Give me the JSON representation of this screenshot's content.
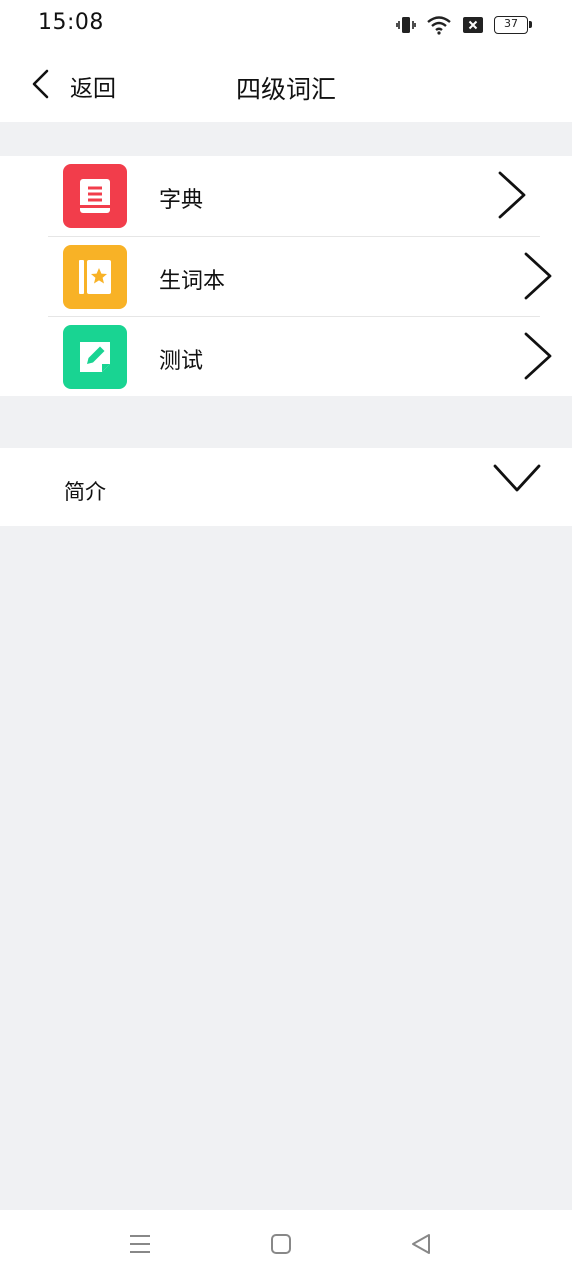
{
  "status_bar": {
    "time": "15:08",
    "battery_level": "37",
    "icons": [
      "vibrate-icon",
      "wifi-icon",
      "sim-blocked-icon",
      "battery-icon"
    ]
  },
  "nav": {
    "back_label": "返回",
    "title": "四级词汇"
  },
  "menu": {
    "items": [
      {
        "label": "字典",
        "icon": "dictionary-book-icon",
        "color": "#f23d4b"
      },
      {
        "label": "生词本",
        "icon": "vocabulary-notebook-star-icon",
        "color": "#f8b226"
      },
      {
        "label": "测试",
        "icon": "test-edit-icon",
        "color": "#19d492"
      }
    ]
  },
  "intro": {
    "label": "简介",
    "state": "collapsed"
  },
  "system_nav": {
    "buttons": [
      "menu-icon",
      "home-icon",
      "back-triangle-icon"
    ]
  },
  "colors": {
    "background": "#f0f1f3",
    "surface": "#ffffff",
    "text": "#111111",
    "divider": "#e6e6e6"
  }
}
